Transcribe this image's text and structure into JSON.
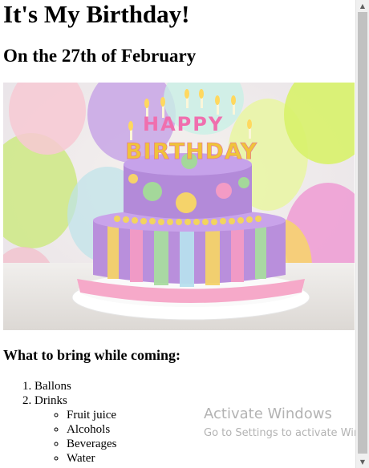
{
  "heading": "It's My Birthday!",
  "subheading": "On the 27th of February",
  "photo": {
    "candle_letters_top": "HAPPY",
    "candle_letters_bottom": "BIRTHDAY"
  },
  "list_heading": "What to bring while coming:",
  "items": [
    {
      "label": "Ballons"
    },
    {
      "label": "Drinks",
      "subitems": [
        "Fruit juice",
        "Alcohols",
        "Beverages",
        "Water"
      ]
    }
  ],
  "watermark": {
    "title": "Activate Windows",
    "subtitle": "Go to Settings to activate Windows."
  },
  "scrollbar": {
    "up_icon": "triangle-up",
    "down_icon": "triangle-down"
  }
}
